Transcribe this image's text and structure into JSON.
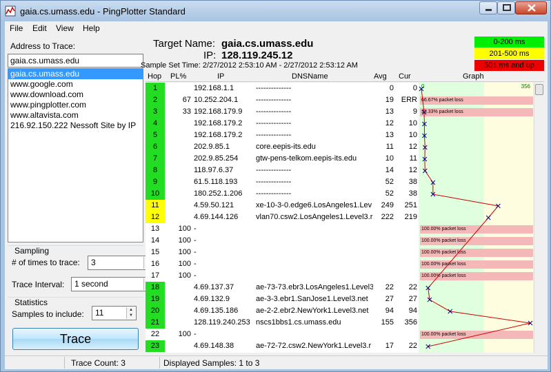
{
  "window": {
    "title": "gaia.cs.umass.edu - PingPlotter Standard",
    "app_icon": "pingplotter-icon"
  },
  "menu": {
    "items": [
      "File",
      "Edit",
      "View",
      "Help"
    ]
  },
  "left": {
    "address_label": "Address to Trace:",
    "address_value": "gaia.cs.umass.edu",
    "list": [
      "gaia.cs.umass.edu",
      "www.google.com",
      "www.download.com",
      "www.pingplotter.com",
      "www.altavista.com",
      "216.92.150.222 Nessoft Site by IP"
    ],
    "selected_index": 0,
    "sampling_label": "Sampling",
    "times_label": "# of times to trace:",
    "times_value": "3",
    "interval_label": "Trace Interval:",
    "interval_value": "1 second",
    "statistics_label": "Statistics",
    "samples_label": "Samples to include:",
    "samples_value": "11",
    "trace_button": "Trace"
  },
  "target": {
    "name_label": "Target Name:",
    "name_value": "gaia.cs.umass.edu",
    "ip_label": "IP:",
    "ip_value": "128.119.245.12",
    "sample_time_label": "Sample Set Time:",
    "sample_time_value": "2/27/2012 2:53:10 AM - 2/27/2012 2:53:12 AM"
  },
  "legend": [
    {
      "label": "0-200 ms",
      "color": "#00ee00",
      "text_color": "#000000"
    },
    {
      "label": "201-500 ms",
      "color": "#ffff00",
      "text_color": "#000000"
    },
    {
      "label": "501 ms and up",
      "color": "#ee0000",
      "text_color": "#000000"
    }
  ],
  "grid": {
    "headers": {
      "hop": "Hop",
      "pl": "PL%",
      "ip": "IP",
      "dns": "DNSName",
      "avg": "Avg",
      "cur": "Cur",
      "graph": "Graph"
    },
    "graph_axis_left": "0",
    "graph_axis_right": "356",
    "graph_max_ms": 356,
    "rows": [
      {
        "hop": "1",
        "pl": "",
        "ip": "192.168.1.1",
        "dns": "--------------",
        "avg": "0",
        "cur": "0",
        "color": "green",
        "loss": ""
      },
      {
        "hop": "2",
        "pl": "67",
        "ip": "10.252.204.1",
        "dns": "--------------",
        "avg": "19",
        "cur": "ERR",
        "color": "green",
        "loss": "66.67% packet loss"
      },
      {
        "hop": "3",
        "pl": "33",
        "ip": "192.168.179.9",
        "dns": "--------------",
        "avg": "13",
        "cur": "9",
        "color": "green",
        "loss": "33.33% packet loss"
      },
      {
        "hop": "4",
        "pl": "",
        "ip": "192.168.179.2",
        "dns": "--------------",
        "avg": "12",
        "cur": "10",
        "color": "green",
        "loss": ""
      },
      {
        "hop": "5",
        "pl": "",
        "ip": "192.168.179.2",
        "dns": "--------------",
        "avg": "13",
        "cur": "10",
        "color": "green",
        "loss": ""
      },
      {
        "hop": "6",
        "pl": "",
        "ip": "202.9.85.1",
        "dns": "core.eepis-its.edu",
        "avg": "11",
        "cur": "12",
        "color": "green",
        "loss": ""
      },
      {
        "hop": "7",
        "pl": "",
        "ip": "202.9.85.254",
        "dns": "gtw-pens-telkom.eepis-its.edu",
        "avg": "10",
        "cur": "11",
        "color": "green",
        "loss": ""
      },
      {
        "hop": "8",
        "pl": "",
        "ip": "118.97.6.37",
        "dns": "--------------",
        "avg": "14",
        "cur": "12",
        "color": "green",
        "loss": ""
      },
      {
        "hop": "9",
        "pl": "",
        "ip": "61.5.118.193",
        "dns": "--------------",
        "avg": "52",
        "cur": "38",
        "color": "green",
        "loss": ""
      },
      {
        "hop": "10",
        "pl": "",
        "ip": "180.252.1.206",
        "dns": "--------------",
        "avg": "52",
        "cur": "38",
        "color": "green",
        "loss": ""
      },
      {
        "hop": "11",
        "pl": "",
        "ip": "4.59.50.121",
        "dns": "xe-10-3-0.edge6.LosAngeles1.Lev",
        "avg": "249",
        "cur": "251",
        "color": "yellow",
        "loss": ""
      },
      {
        "hop": "12",
        "pl": "",
        "ip": "4.69.144.126",
        "dns": "vlan70.csw2.LosAngeles1.Level3.r",
        "avg": "222",
        "cur": "219",
        "color": "yellow",
        "loss": ""
      },
      {
        "hop": "13",
        "pl": "100",
        "ip": "-",
        "dns": "",
        "avg": "",
        "cur": "",
        "color": "none",
        "loss": "100.00% packet loss"
      },
      {
        "hop": "14",
        "pl": "100",
        "ip": "-",
        "dns": "",
        "avg": "",
        "cur": "",
        "color": "none",
        "loss": "100.00% packet loss"
      },
      {
        "hop": "15",
        "pl": "100",
        "ip": "-",
        "dns": "",
        "avg": "",
        "cur": "",
        "color": "none",
        "loss": "100.00% packet loss"
      },
      {
        "hop": "16",
        "pl": "100",
        "ip": "-",
        "dns": "",
        "avg": "",
        "cur": "",
        "color": "none",
        "loss": "100.00% packet loss"
      },
      {
        "hop": "17",
        "pl": "100",
        "ip": "-",
        "dns": "",
        "avg": "",
        "cur": "",
        "color": "none",
        "loss": "100.00% packet loss"
      },
      {
        "hop": "18",
        "pl": "",
        "ip": "4.69.137.37",
        "dns": "ae-73-73.ebr3.LosAngeles1.Level3",
        "avg": "22",
        "cur": "22",
        "color": "green",
        "loss": ""
      },
      {
        "hop": "19",
        "pl": "",
        "ip": "4.69.132.9",
        "dns": "ae-3-3.ebr1.SanJose1.Level3.net",
        "avg": "27",
        "cur": "27",
        "color": "green",
        "loss": ""
      },
      {
        "hop": "20",
        "pl": "",
        "ip": "4.69.135.186",
        "dns": "ae-2-2.ebr2.NewYork1.Level3.net",
        "avg": "94",
        "cur": "94",
        "color": "green",
        "loss": ""
      },
      {
        "hop": "21",
        "pl": "",
        "ip": "128.119.240.253",
        "dns": "nscs1bbs1.cs.umass.edu",
        "avg": "155",
        "cur": "356",
        "color": "green",
        "loss": ""
      },
      {
        "hop": "22",
        "pl": "100",
        "ip": "-",
        "dns": "",
        "avg": "",
        "cur": "",
        "color": "none",
        "loss": "100.00% packet loss"
      },
      {
        "hop": "23",
        "pl": "",
        "ip": "4.69.148.38",
        "dns": "ae-72-72.csw2.NewYork1.Level3.r",
        "avg": "17",
        "cur": "22",
        "color": "green",
        "loss": ""
      }
    ]
  },
  "status": {
    "trace_count": "Trace Count: 3",
    "displayed_samples": "Displayed Samples: 1 to 3"
  },
  "colors": {
    "green": "#22dd22",
    "yellow": "#ffff00",
    "graph_green": "#dfffdf",
    "graph_yellow": "#fffde0",
    "line": "#cc0000",
    "marker": "#000080"
  }
}
